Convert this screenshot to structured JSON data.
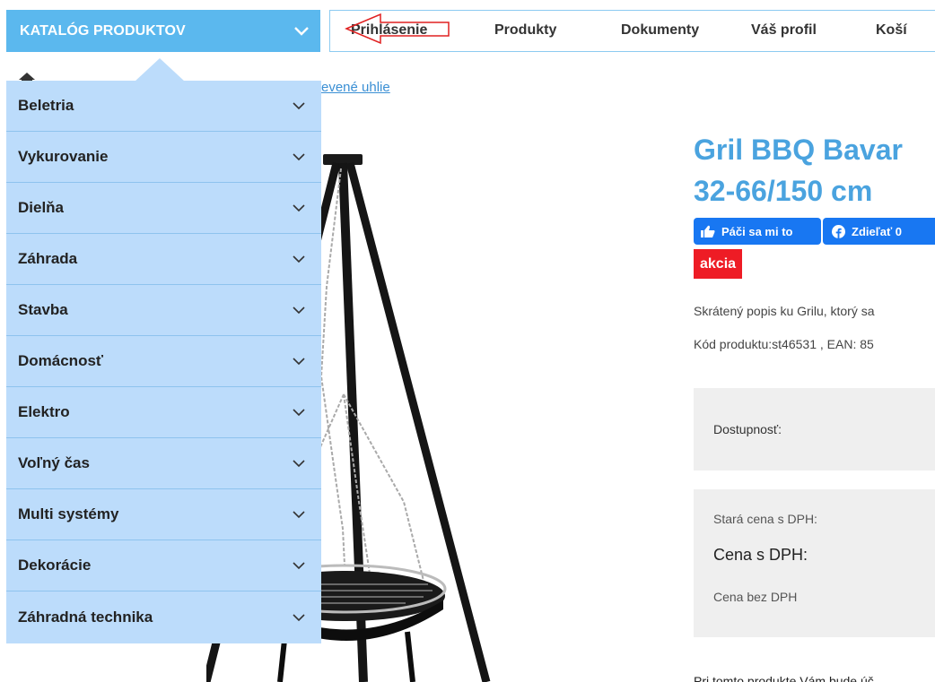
{
  "header": {
    "catalog_label": "KATALÓG PRODUKTOV",
    "nav": [
      "Prihlásenie",
      "Produkty",
      "Dokumenty",
      "Váš profil",
      "Koší"
    ]
  },
  "breadcrumb": {
    "link_text": "evené uhlie"
  },
  "categories": [
    {
      "label": "Beletria"
    },
    {
      "label": "Vykurovanie"
    },
    {
      "label": "Dielňa"
    },
    {
      "label": "Záhrada"
    },
    {
      "label": "Stavba"
    },
    {
      "label": "Domácnosť"
    },
    {
      "label": "Elektro"
    },
    {
      "label": "Voľný čas"
    },
    {
      "label": "Multi systémy"
    },
    {
      "label": "Dekorácie"
    },
    {
      "label": "Záhradná technika"
    }
  ],
  "product": {
    "title_line1": "Gril BBQ Bavar",
    "title_line2": "32-66/150 cm",
    "fb_like": "Páči sa mi to",
    "fb_share": "Zdieľať 0",
    "badge": "akcia",
    "short_desc": "Skrátený popis ku Grilu, ktorý sa",
    "code_line": "Kód produktu:st46531 , EAN: 85",
    "availability_label": "Dostupnosť:",
    "old_price_label": "Stará cena s DPH:",
    "price_vat_label": "Cena s DPH:",
    "price_novat_label": "Cena bez DPH",
    "bottom_text": "Pri tomto produkte Vám bude úč"
  },
  "colors": {
    "accent": "#5bb8ee",
    "dropdown_bg": "#bcdcfb",
    "title": "#4aa3df",
    "badge": "#ee1c25",
    "facebook": "#1877f2",
    "annotation": "#e02020"
  }
}
